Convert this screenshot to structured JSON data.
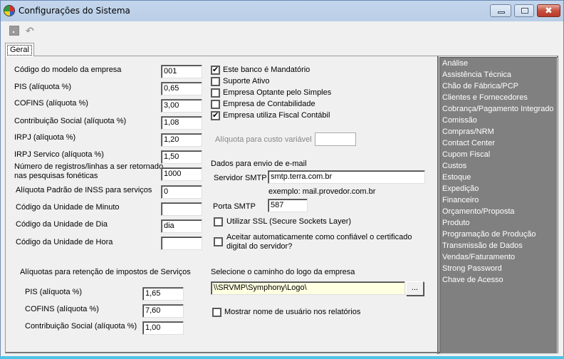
{
  "window": {
    "title": "Configurações do Sistema",
    "buttons": {
      "minimize": "minimize",
      "maximize": "maximize",
      "close": "✖"
    }
  },
  "toolbar": {
    "icons": [
      "save-icon",
      "undo-icon"
    ],
    "undo_glyph": "↶"
  },
  "tabs": [
    {
      "label": "Geral",
      "active": true
    }
  ],
  "left_fields": [
    {
      "label": "Código do modelo da empresa",
      "value": "001"
    },
    {
      "label": "PIS (alíquota %)",
      "value": "0,65"
    },
    {
      "label": "COFINS (alíquota %)",
      "value": "3,00"
    },
    {
      "label": "Contribuição Social (alíquota %)",
      "value": "1,08"
    },
    {
      "label": "IRPJ (alíquota %)",
      "value": "1,20"
    },
    {
      "label": "IRPJ Servico (alíquota %)",
      "value": "1,50"
    },
    {
      "label_line1": "Número de registros/linhas a ser retornado",
      "label_line2": "nas pesquisas fonéticas",
      "value": "1000"
    },
    {
      "label": "Alíquota Padrão de INSS para serviços",
      "value": "0"
    },
    {
      "label": "Código da Unidade de Minuto",
      "value": ""
    },
    {
      "label": "Código da Unidade de Dia",
      "value": "dia"
    },
    {
      "label": "Código da Unidade de Hora",
      "value": ""
    }
  ],
  "retention": {
    "title": "Alíquotas para retenção de impostos de Serviços",
    "fields": [
      {
        "label": "PIS (alíquota %)",
        "value": "1,65"
      },
      {
        "label": "COFINS (alíquota %)",
        "value": "7,60"
      },
      {
        "label": "Contribuição Social (alíquota %)",
        "value": "1,00"
      }
    ]
  },
  "checkboxes": [
    {
      "label": "Este banco  é  Mandatório",
      "checked": true
    },
    {
      "label": "Suporte Ativo",
      "checked": false
    },
    {
      "label": "Empresa Optante pelo Simples",
      "checked": false
    },
    {
      "label": "Empresa de Contabilidade",
      "checked": false
    },
    {
      "label": "Empresa utiliza Fiscal Contábil",
      "checked": true
    }
  ],
  "variable_cost": {
    "label": "Alíquota para custo variável",
    "value": "",
    "disabled": true
  },
  "email": {
    "section_title": "Dados para envio de e-mail",
    "smtp_server_label": "Servidor SMTP",
    "smtp_server_value": "smtp.terra.com.br",
    "example": "exemplo: mail.provedor.com.br",
    "smtp_port_label": "Porta SMTP",
    "smtp_port_value": "587",
    "ssl_label": "Utilizar SSL (Secure Sockets Layer)",
    "ssl_checked": false,
    "cert_label_line1": "Aceitar automaticamente como confiável o certificado",
    "cert_label_line2": "digital do servidor?",
    "cert_checked": false
  },
  "logo": {
    "label": "Selecione  o caminho do logo da empresa",
    "path": "\\\\SRVMP\\Symphony\\Logo\\",
    "browse_label": "..."
  },
  "show_username": {
    "label": "Mostrar nome de usuário nos relatórios",
    "checked": false
  },
  "modules": [
    "Análise",
    "Assistência Técnica",
    "Chão de Fábrica/PCP",
    "Clientes e Fornecedores",
    "Cobrança/Pagamento Integrado",
    "Comissão",
    "Compras/NRM",
    "Contact Center",
    "Cupom Fiscal",
    "Custos",
    "Estoque",
    "Expedição",
    "Financeiro",
    "Orçamento/Proposta",
    "Produto",
    "Programação de Produção",
    "Transmissão de Dados",
    "Vendas/Faturamento",
    "Strong Password",
    "Chave de Acesso"
  ]
}
